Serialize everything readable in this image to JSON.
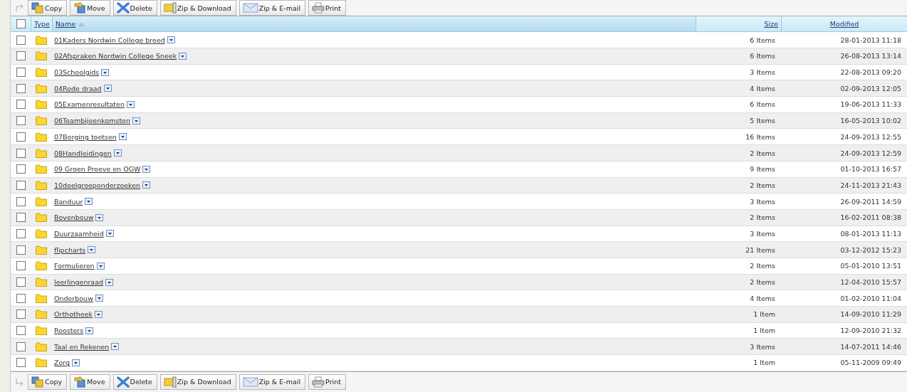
{
  "toolbar_top": {
    "buttons": [
      {
        "kind": "copy",
        "label": "Copy"
      },
      {
        "kind": "move",
        "label": "Move"
      },
      {
        "kind": "delete",
        "label": "Delete"
      },
      {
        "kind": "zip-download",
        "label": "Zip & Download"
      },
      {
        "kind": "zip-email",
        "label": "Zip & E-mail"
      },
      {
        "kind": "print",
        "label": "Print"
      }
    ]
  },
  "table": {
    "select_all": {
      "checked": false
    },
    "columns": [
      {
        "label": "Type",
        "sorted": false
      },
      {
        "label": "Name",
        "sorted": true
      },
      {
        "label": "Size",
        "sorted": false
      },
      {
        "label": "Modified",
        "sorted": false
      }
    ],
    "rows": [
      {
        "checked": false,
        "name": "01Kaders Nordwin College breed",
        "size": "6 Items",
        "modified": "28-01-2013 11:18"
      },
      {
        "checked": false,
        "name": "02Afspraken Nordwin College Sneek",
        "size": "6 Items",
        "modified": "26-08-2013 13:14"
      },
      {
        "checked": false,
        "name": "03Schoolgids",
        "size": "3 Items",
        "modified": "22-08-2013 09:20"
      },
      {
        "checked": false,
        "name": "04Rode draad",
        "size": "4 Items",
        "modified": "02-09-2013 12:05"
      },
      {
        "checked": false,
        "name": "05Examenresultaten",
        "size": "6 Items",
        "modified": "19-06-2013 11:33"
      },
      {
        "checked": false,
        "name": "06Teambijeenkomsten",
        "size": "5 Items",
        "modified": "16-05-2013 10:02"
      },
      {
        "checked": false,
        "name": "07Borging toetsen",
        "size": "16 Items",
        "modified": "24-09-2013 12:55"
      },
      {
        "checked": false,
        "name": "08Handleidingen",
        "size": "2 Items",
        "modified": "24-09-2013 12:59"
      },
      {
        "checked": false,
        "name": "09 Groen Proeve en OGW",
        "size": "9 Items",
        "modified": "01-10-2013 16:57"
      },
      {
        "checked": false,
        "name": "10doelgroeponderzoeken",
        "size": "2 Items",
        "modified": "24-11-2013 21:43"
      },
      {
        "checked": false,
        "name": "Banduur",
        "size": "3 Items",
        "modified": "26-09-2011 14:59"
      },
      {
        "checked": false,
        "name": "Bovenbouw",
        "size": "2 Items",
        "modified": "16-02-2011 08:38"
      },
      {
        "checked": false,
        "name": "Duurzaamheid",
        "size": "3 Items",
        "modified": "08-01-2013 11:13"
      },
      {
        "checked": false,
        "name": "flipcharts",
        "size": "21 Items",
        "modified": "03-12-2012 15:23"
      },
      {
        "checked": false,
        "name": "Formulieren",
        "size": "2 Items",
        "modified": "05-01-2010 13:51"
      },
      {
        "checked": false,
        "name": "leerlingenraad",
        "size": "2 Items",
        "modified": "12-04-2010 15:57"
      },
      {
        "checked": false,
        "name": "Onderbouw",
        "size": "4 Items",
        "modified": "01-02-2010 11:04"
      },
      {
        "checked": false,
        "name": "Orthotheek",
        "size": "1 Item",
        "modified": "14-09-2010 11:29"
      },
      {
        "checked": false,
        "name": "Roosters",
        "size": "1 Item",
        "modified": "12-09-2010 21:32"
      },
      {
        "checked": false,
        "name": "Taal en Rekenen",
        "size": "3 Items",
        "modified": "14-07-2011 14:46"
      },
      {
        "checked": false,
        "name": "Zorg",
        "size": "1 Item",
        "modified": "05-11-2009 09:49"
      }
    ]
  },
  "toolbar_bottom": {
    "buttons": [
      {
        "kind": "copy",
        "label": "Copy"
      },
      {
        "kind": "move",
        "label": "Move"
      },
      {
        "kind": "delete",
        "label": "Delete"
      },
      {
        "kind": "zip-download",
        "label": "Zip & Download"
      },
      {
        "kind": "zip-email",
        "label": "Zip & E-mail"
      },
      {
        "kind": "print",
        "label": "Print"
      }
    ]
  }
}
